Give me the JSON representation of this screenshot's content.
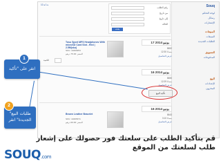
{
  "window": {
    "pager": "10 ◂ 1 ▸",
    "nav_logo": "Souq",
    "nav_links": [
      "لوحة التحكم",
      "رسائل",
      "الإشعارات",
      "المبيعات",
      "الطلبات الجديدة",
      "المدفوعات",
      "الإعدادات",
      "المخزون"
    ],
    "nav_sections": [
      "المبيعات",
      "التسويق",
      "البيع"
    ],
    "filters": {
      "rows": [
        "رقم الطلب",
        "من تاريخ",
        "إلى تاريخ",
        "الحالة"
      ],
      "search": "بحث"
    },
    "orders": [
      {
        "date": "17 يونيو 2014",
        "id": "8652",
        "meta": "12:30 مساءً",
        "link": "عرض التفاصيل"
      },
      {
        "date": "16 يونيو 2014",
        "id": "8650",
        "meta": "12:29 مساءً",
        "link": "عرض التفاصيل"
      },
      {
        "date": "16 يونيو 2014",
        "id": "8643",
        "meta": "3:10 مساءً",
        "link": "عرض التفاصيل"
      }
    ],
    "products": [
      {
        "title": "Tosu Sport MP3 Headphones With microSD Card Slot - Red | 2.5M(sku)",
        "line1": "SKU: 10469254",
        "line2": "السعر: 75.00 درهم",
        "qty_label": "الكمية"
      },
      {
        "title": "Brown Leather Bracelet",
        "line1": "SKU: 10465371",
        "line2": "السعر: 60.00 درهم",
        "qty_label": "الكمية"
      }
    ],
    "confirm_button": "تأكيد البيع"
  },
  "callouts": [
    {
      "number": "1",
      "text": "انقر على \"تأكيد البيع\""
    },
    {
      "number": "2",
      "text": "\"طلبات البيع الجديدة\" انقر"
    }
  ],
  "caption": "قم بتأكيد الطلب على سلعتك فور حصولك على إشعار طلب لسلعتك من الموقع",
  "brand": {
    "name": "SOUQ",
    "suffix": ".com"
  },
  "colors": {
    "accent": "#2f6fc0",
    "badge2": "#f0a21f",
    "ring": "#d92b2b",
    "brand": "#1c5eab"
  }
}
